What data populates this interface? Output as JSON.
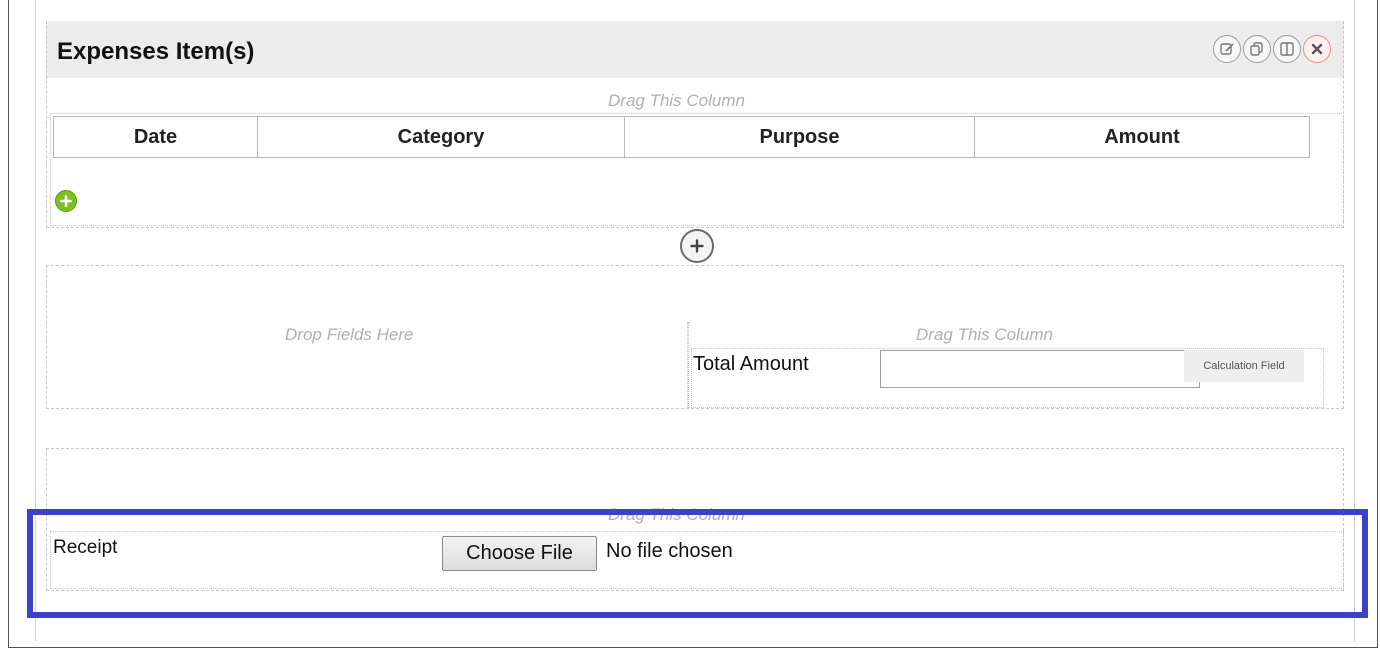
{
  "section": {
    "title": "Expenses Item(s)",
    "icons": [
      "edit-icon",
      "copy-icon",
      "columns-icon",
      "close-icon"
    ]
  },
  "table": {
    "drag_label": "Drag This Column",
    "columns": [
      "Date",
      "Category",
      "Purpose",
      "Amount"
    ]
  },
  "middle": {
    "drop_label": "Drop Fields Here",
    "drag_label": "Drag This Column",
    "total_label": "Total Amount",
    "calc_badge": "Calculation Field"
  },
  "receipt": {
    "drag_label": "Drag This Column",
    "label": "Receipt",
    "choose_button": "Choose File",
    "file_status": "No file chosen"
  },
  "colors": {
    "highlight": "#3b42c8",
    "add_green": "#7cc21e",
    "close_red": "#e05050"
  }
}
